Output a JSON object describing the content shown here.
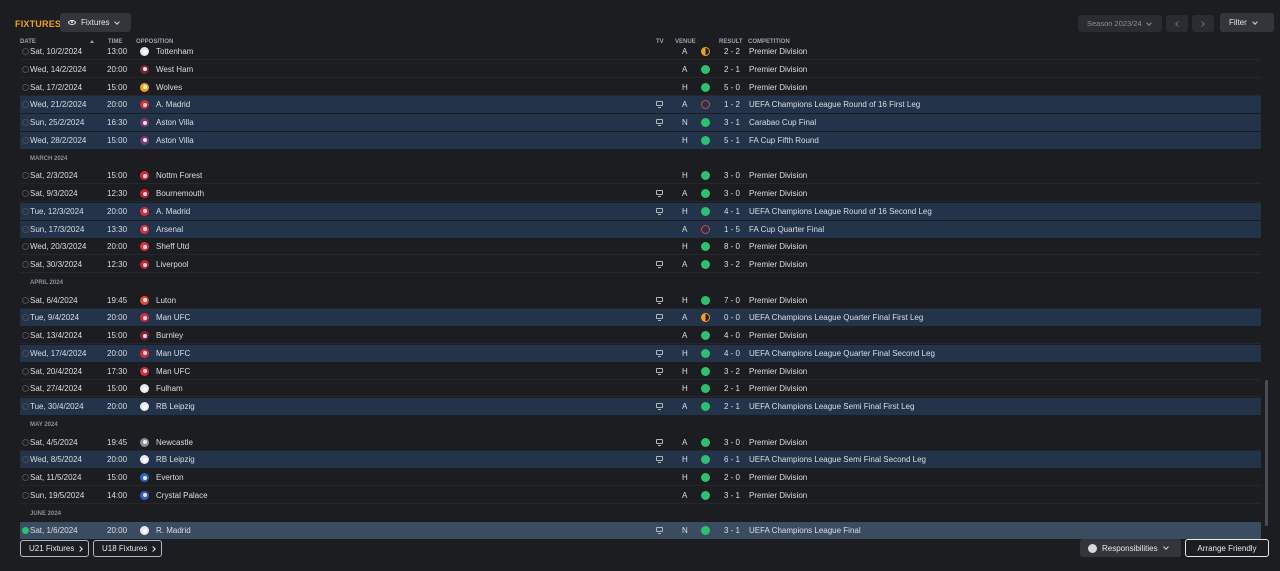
{
  "header": {
    "title": "FIXTURES",
    "view_label": "Fixtures",
    "season_label": "Season 2023/24",
    "filter_label": "Filter"
  },
  "columns": {
    "date": "DATE",
    "time": "TIME",
    "opposition": "OPPOSITION",
    "tv": "TV",
    "venue": "VENUE",
    "result": "RESULT",
    "competition": "COMPETITION"
  },
  "fixtures": [
    {
      "date": "Sat, 10/2/2024",
      "time": "13:00",
      "opposition": "Tottenham",
      "crest_color": "#e8e8f0",
      "tv": false,
      "venue": "A",
      "outcome": "D",
      "score": "2 - 2",
      "competition": "Premier Division",
      "type": "league"
    },
    {
      "date": "Wed, 14/2/2024",
      "time": "20:00",
      "opposition": "West Ham",
      "crest_color": "#7a2638",
      "tv": false,
      "venue": "A",
      "outcome": "W",
      "score": "2 - 1",
      "competition": "Premier Division",
      "type": "league"
    },
    {
      "date": "Sat, 17/2/2024",
      "time": "15:00",
      "opposition": "Wolves",
      "crest_color": "#f0a21c",
      "tv": false,
      "venue": "H",
      "outcome": "W",
      "score": "5 - 0",
      "competition": "Premier Division",
      "type": "league"
    },
    {
      "date": "Wed, 21/2/2024",
      "time": "20:00",
      "opposition": "A. Madrid",
      "crest_color": "#d8283a",
      "tv": true,
      "venue": "A",
      "outcome": "L",
      "score": "1 - 2",
      "competition": "UEFA Champions League Round of 16  First Leg",
      "type": "cup"
    },
    {
      "date": "Sun, 25/2/2024",
      "time": "16:30",
      "opposition": "Aston Villa",
      "crest_color": "#7b3a6e",
      "tv": true,
      "venue": "N",
      "outcome": "W",
      "score": "3 - 1",
      "competition": "Carabao Cup Final",
      "type": "cup"
    },
    {
      "date": "Wed, 28/2/2024",
      "time": "15:00",
      "opposition": "Aston Villa",
      "crest_color": "#7b3a6e",
      "tv": false,
      "venue": "H",
      "outcome": "W",
      "score": "5 - 1",
      "competition": "FA Cup Fifth Round",
      "type": "cup"
    },
    {
      "month": "MARCH 2024"
    },
    {
      "date": "Sat, 2/3/2024",
      "time": "15:00",
      "opposition": "Nottm Forest",
      "crest_color": "#d8283a",
      "tv": false,
      "venue": "H",
      "outcome": "W",
      "score": "3 - 0",
      "competition": "Premier Division",
      "type": "league"
    },
    {
      "date": "Sat, 9/3/2024",
      "time": "12:30",
      "opposition": "Bournemouth",
      "crest_color": "#c8202c",
      "tv": true,
      "venue": "A",
      "outcome": "W",
      "score": "3 - 0",
      "competition": "Premier Division",
      "type": "league"
    },
    {
      "date": "Tue, 12/3/2024",
      "time": "20:00",
      "opposition": "A. Madrid",
      "crest_color": "#d8283a",
      "tv": true,
      "venue": "H",
      "outcome": "W",
      "score": "4 - 1",
      "competition": "UEFA Champions League Round of 16  Second Leg",
      "type": "cup"
    },
    {
      "date": "Sun, 17/3/2024",
      "time": "13:30",
      "opposition": "Arsenal",
      "crest_color": "#e03040",
      "tv": false,
      "venue": "A",
      "outcome": "L",
      "score": "1 - 5",
      "competition": "FA Cup Quarter Final",
      "type": "cup"
    },
    {
      "date": "Wed, 20/3/2024",
      "time": "20:00",
      "opposition": "Sheff Utd",
      "crest_color": "#e03040",
      "tv": false,
      "venue": "H",
      "outcome": "W",
      "score": "8 - 0",
      "competition": "Premier Division",
      "type": "league"
    },
    {
      "date": "Sat, 30/3/2024",
      "time": "12:30",
      "opposition": "Liverpool",
      "crest_color": "#c8202c",
      "tv": true,
      "venue": "A",
      "outcome": "W",
      "score": "3 - 2",
      "competition": "Premier Division",
      "type": "league"
    },
    {
      "month": "APRIL 2024"
    },
    {
      "date": "Sat, 6/4/2024",
      "time": "19:45",
      "opposition": "Luton",
      "crest_color": "#e0483a",
      "tv": true,
      "venue": "H",
      "outcome": "W",
      "score": "7 - 0",
      "competition": "Premier Division",
      "type": "league"
    },
    {
      "date": "Tue, 9/4/2024",
      "time": "20:00",
      "opposition": "Man UFC",
      "crest_color": "#d8283a",
      "tv": true,
      "venue": "A",
      "outcome": "D",
      "score": "0 - 0",
      "competition": "UEFA Champions League Quarter Final First Leg",
      "type": "cup"
    },
    {
      "date": "Sat, 13/4/2024",
      "time": "15:00",
      "opposition": "Burnley",
      "crest_color": "#8a2040",
      "tv": false,
      "venue": "A",
      "outcome": "W",
      "score": "4 - 0",
      "competition": "Premier Division",
      "type": "league"
    },
    {
      "date": "Wed, 17/4/2024",
      "time": "20:00",
      "opposition": "Man UFC",
      "crest_color": "#d8283a",
      "tv": true,
      "venue": "H",
      "outcome": "W",
      "score": "4 - 0",
      "competition": "UEFA Champions League Quarter Final Second Leg",
      "type": "cup"
    },
    {
      "date": "Sat, 20/4/2024",
      "time": "17:30",
      "opposition": "Man UFC",
      "crest_color": "#d8283a",
      "tv": true,
      "venue": "H",
      "outcome": "W",
      "score": "3 - 2",
      "competition": "Premier Division",
      "type": "league"
    },
    {
      "date": "Sat, 27/4/2024",
      "time": "15:00",
      "opposition": "Fulham",
      "crest_color": "#e8e8f0",
      "tv": false,
      "venue": "H",
      "outcome": "W",
      "score": "2 - 1",
      "competition": "Premier Division",
      "type": "league"
    },
    {
      "date": "Tue, 30/4/2024",
      "time": "20:00",
      "opposition": "RB Leipzig",
      "crest_color": "#e8e8f0",
      "tv": true,
      "venue": "A",
      "outcome": "W",
      "score": "2 - 1",
      "competition": "UEFA Champions League Semi Final First Leg",
      "type": "cup"
    },
    {
      "month": "MAY 2024"
    },
    {
      "date": "Sat, 4/5/2024",
      "time": "19:45",
      "opposition": "Newcastle",
      "crest_color": "#8a8d95",
      "tv": true,
      "venue": "A",
      "outcome": "W",
      "score": "3 - 0",
      "competition": "Premier Division",
      "type": "league"
    },
    {
      "date": "Wed, 8/5/2024",
      "time": "20:00",
      "opposition": "RB Leipzig",
      "crest_color": "#e8e8f0",
      "tv": true,
      "venue": "H",
      "outcome": "W",
      "score": "6 - 1",
      "competition": "UEFA Champions League Semi Final Second Leg",
      "type": "cup"
    },
    {
      "date": "Sat, 11/5/2024",
      "time": "15:00",
      "opposition": "Everton",
      "crest_color": "#2f62c8",
      "tv": false,
      "venue": "H",
      "outcome": "W",
      "score": "2 - 0",
      "competition": "Premier Division",
      "type": "league"
    },
    {
      "date": "Sun, 19/5/2024",
      "time": "14:00",
      "opposition": "Crystal Palace",
      "crest_color": "#3a5ac8",
      "tv": false,
      "venue": "A",
      "outcome": "W",
      "score": "3 - 1",
      "competition": "Premier Division",
      "type": "league"
    },
    {
      "month": "JUNE 2024"
    },
    {
      "date": "Sat, 1/6/2024",
      "time": "20:00",
      "opposition": "R. Madrid",
      "crest_color": "#e8e8f0",
      "tv": true,
      "venue": "N",
      "outcome": "W",
      "score": "3 - 1",
      "competition": "UEFA Champions League Final",
      "type": "sel"
    }
  ],
  "footer": {
    "u21_label": "U21 Fixtures",
    "u18_label": "U18 Fixtures",
    "responsibilities_label": "Responsibilities",
    "arrange_label": "Arrange Friendly"
  }
}
